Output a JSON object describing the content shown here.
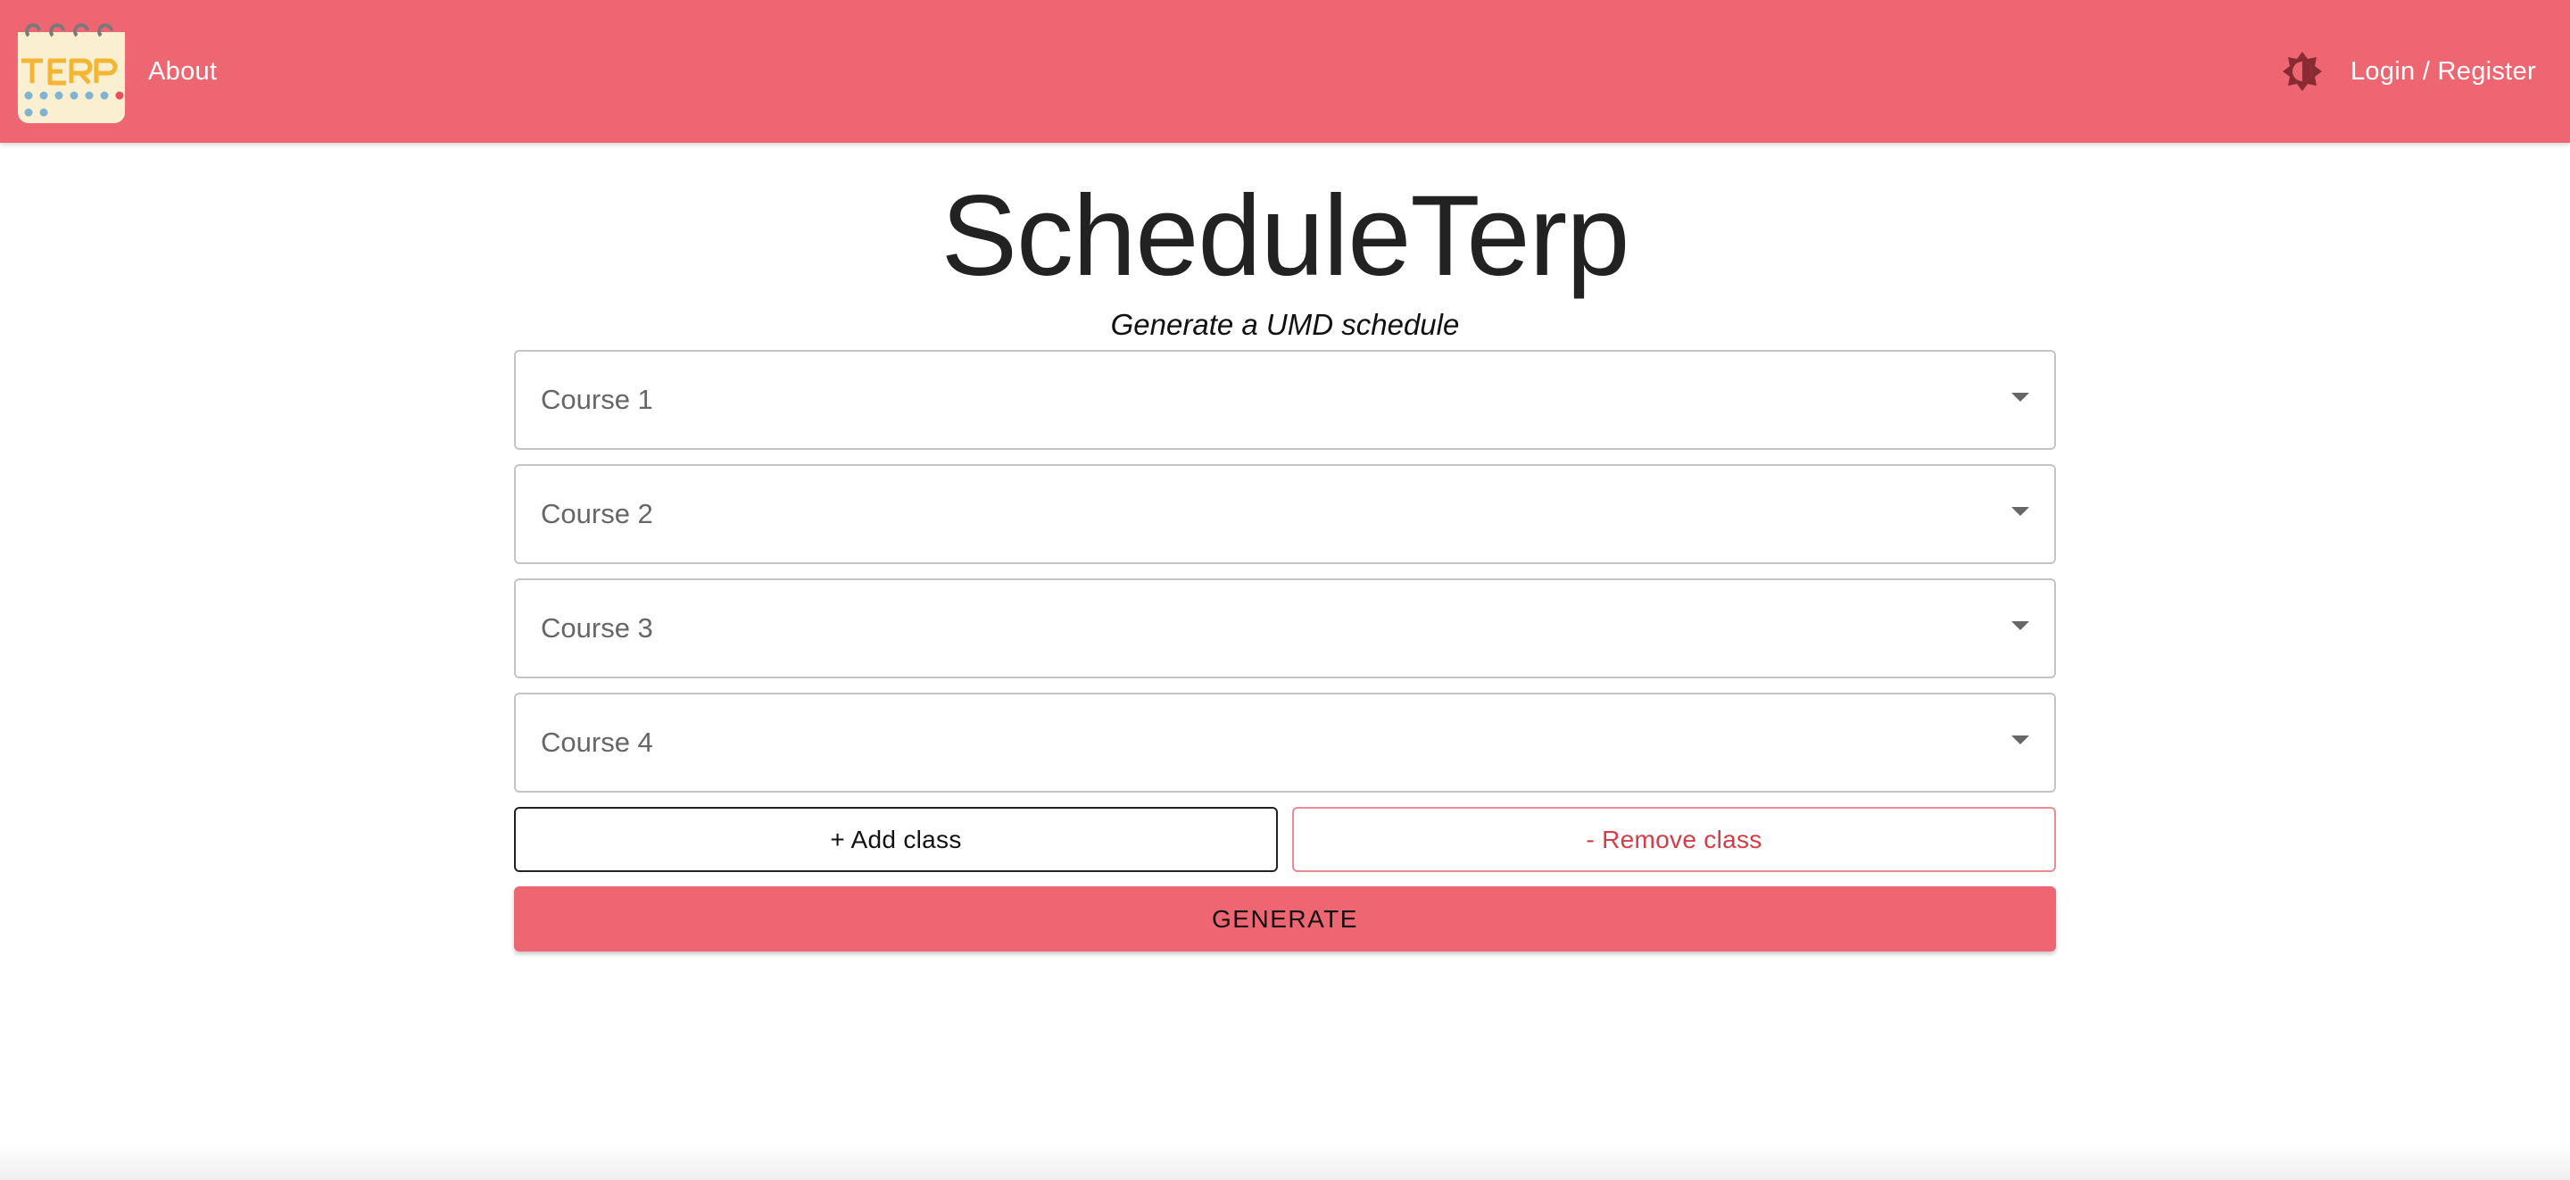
{
  "header": {
    "logo_text": "TERP",
    "about_label": "About",
    "theme_toggle_icon": "brightness-icon",
    "login_label": "Login / Register",
    "background_color": "#ee6671"
  },
  "main": {
    "title": "ScheduleTerp",
    "subtitle": "Generate a UMD schedule",
    "courses": [
      {
        "placeholder": "Course 1"
      },
      {
        "placeholder": "Course 2"
      },
      {
        "placeholder": "Course 3"
      },
      {
        "placeholder": "Course 4"
      }
    ],
    "add_class_label": "+ Add class",
    "remove_class_label": "- Remove class",
    "generate_label": "GENERATE"
  },
  "colors": {
    "accent": "#ee6671",
    "remove_text": "#d63c48",
    "remove_border": "#ef8a92"
  }
}
